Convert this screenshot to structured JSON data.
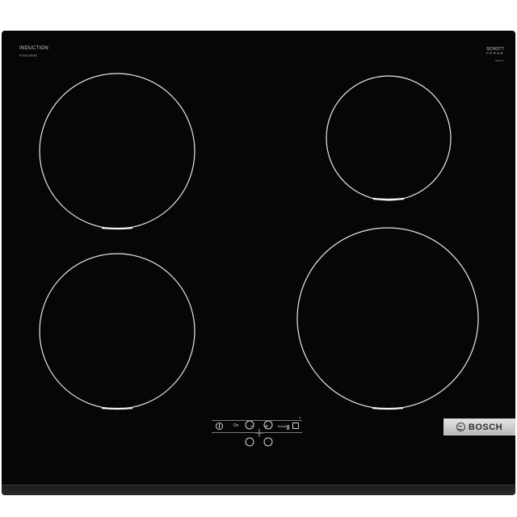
{
  "product": {
    "top_left_label": "INDUCTION",
    "top_left_sub": "PUE631BB5E",
    "top_right_brand_line1": "SCHOTT",
    "top_right_brand_line2": "CERAN",
    "top_right_sub": "SERIE 4",
    "badge_text": "BOSCH"
  },
  "controls": {
    "onoff_label": "On",
    "minus_label": "−",
    "plus_label": "+",
    "boost_label": "boost",
    "small_label": "⊞"
  },
  "colors": {
    "glass": "#060606",
    "zone_ring": "#e8e8e8",
    "badge_bg": "#cfcfcf"
  },
  "icons": [
    "power-icon",
    "minus-icon",
    "plus-icon",
    "timer-icon",
    "zone-selector-icon",
    "pause-icon",
    "bosch-logo-icon"
  ]
}
